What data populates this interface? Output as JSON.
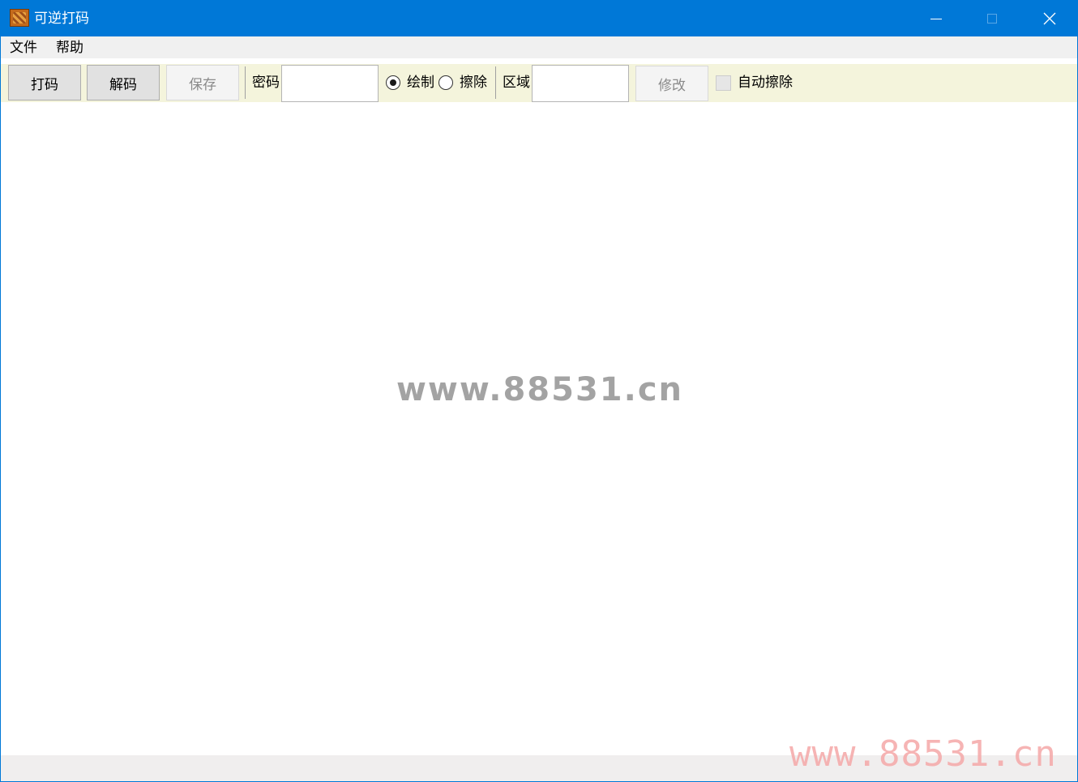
{
  "window": {
    "title": "可逆打码"
  },
  "menu": {
    "items": [
      {
        "label": "文件"
      },
      {
        "label": "帮助"
      }
    ]
  },
  "toolbar": {
    "encode_label": "打码",
    "decode_label": "解码",
    "save_label": "保存",
    "password_label": "密码",
    "password_value": "",
    "draw_label": "绘制",
    "erase_label": "擦除",
    "mode_selected": "绘制",
    "area_label": "区域",
    "area_value": "",
    "modify_label": "修改",
    "auto_erase_label": "自动擦除",
    "auto_erase_checked": false
  },
  "watermarks": {
    "center": "www.88531.cn",
    "corner": "www.88531.cn"
  },
  "colors": {
    "titlebar": "#0078d7",
    "toolbar_bg": "#f4f4dc",
    "corner_watermark": "#f5a8a8"
  }
}
